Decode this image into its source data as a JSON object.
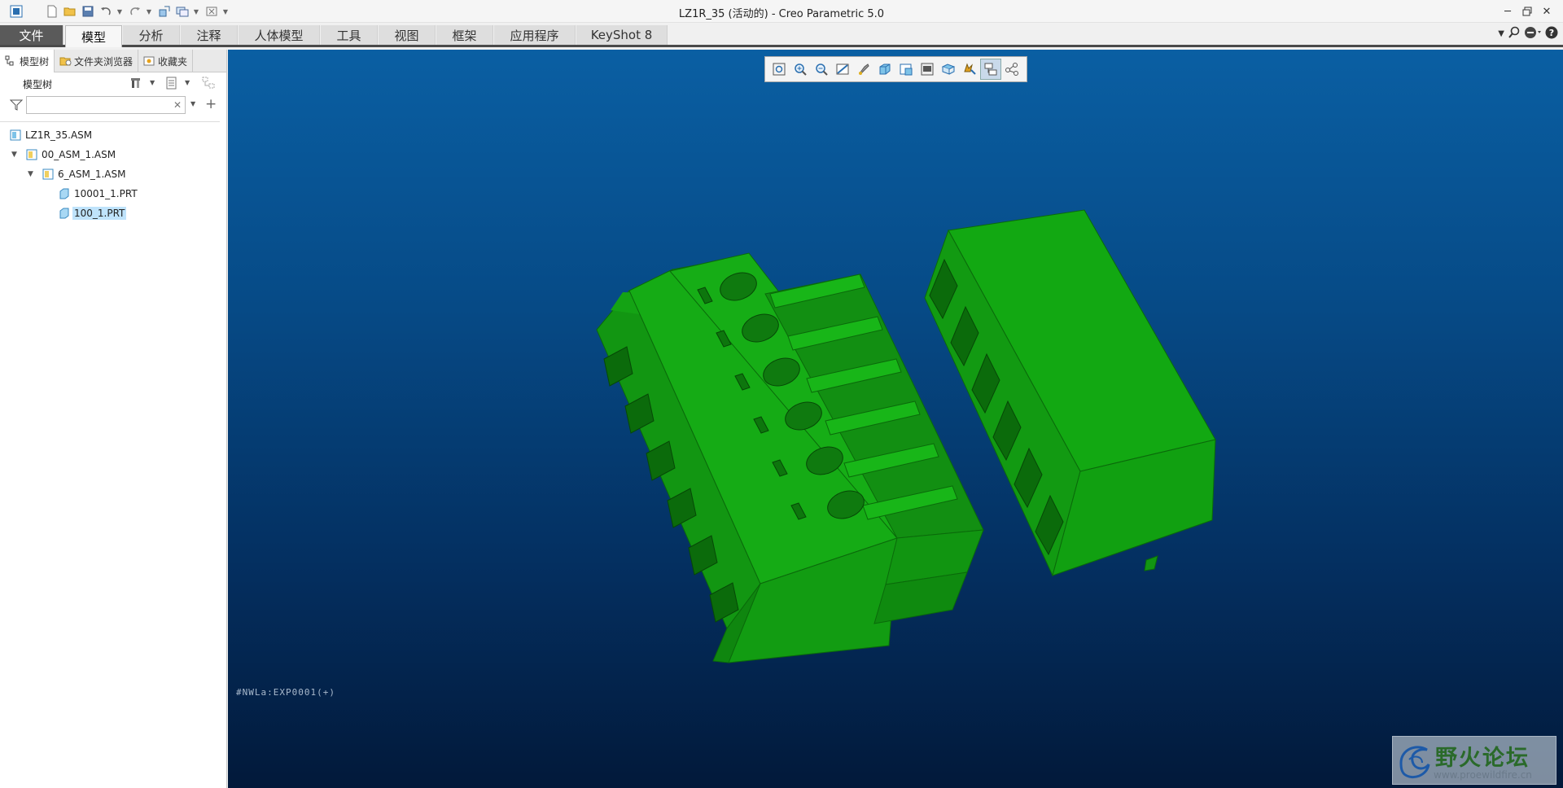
{
  "window": {
    "title": "LZ1R_35 (活动的) - Creo Parametric 5.0",
    "controls": [
      "minimize-icon",
      "restore-icon",
      "close-icon"
    ]
  },
  "quick_access": [
    "app-menu-icon",
    "new-icon",
    "open-icon",
    "save-icon",
    "undo-icon",
    "redo-icon",
    "regenerate-icon",
    "windows-icon",
    "close-window-icon",
    "customize-icon"
  ],
  "ribbon": {
    "tabs": [
      {
        "label": "文件",
        "kind": "file"
      },
      {
        "label": "模型",
        "kind": "active"
      },
      {
        "label": "分析"
      },
      {
        "label": "注释"
      },
      {
        "label": "人体模型"
      },
      {
        "label": "工具"
      },
      {
        "label": "视图"
      },
      {
        "label": "框架"
      },
      {
        "label": "应用程序"
      },
      {
        "label": "KeyShot 8"
      }
    ],
    "right_icons": [
      "collapse-ribbon-icon",
      "search-icon",
      "community-icon",
      "help-icon"
    ]
  },
  "navigator": {
    "tabs": [
      {
        "label": "模型树",
        "icon": "model-tree-icon",
        "active": true
      },
      {
        "label": "文件夹浏览器",
        "icon": "folder-browser-icon"
      },
      {
        "label": "收藏夹",
        "icon": "favorites-icon"
      }
    ],
    "tree_header": "模型树",
    "search": {
      "value": "",
      "placeholder": ""
    },
    "tree": [
      {
        "label": "LZ1R_35.ASM",
        "type": "asm",
        "level": 0,
        "expandable": false
      },
      {
        "label": "00_ASM_1.ASM",
        "type": "asm",
        "level": 1,
        "expandable": true
      },
      {
        "label": "6_ASM_1.ASM",
        "type": "asm",
        "level": 2,
        "expandable": true
      },
      {
        "label": "10001_1.PRT",
        "type": "prt",
        "level": 3,
        "expandable": false
      },
      {
        "label": "100_1.PRT",
        "type": "prt",
        "level": 3,
        "expandable": false,
        "selected": true
      }
    ]
  },
  "graphics": {
    "view_toolbar": [
      "refit-icon",
      "zoom-in-icon",
      "zoom-out-icon",
      "repaint-icon",
      "perspective-icon",
      "display-style-icon",
      "saved-orientations-icon",
      "view-manager-icon",
      "section-icon",
      "appearance-icon",
      "datum-display-icon",
      "annotation-display-icon",
      "spin-center-icon"
    ],
    "status_label": "#NWLa:EXP0001(+)",
    "model_color": "#12a412",
    "background_top": "#0a5fa3",
    "background_bottom": "#02193a"
  },
  "watermark": {
    "title": "野火论坛",
    "url": "www.proewildfire.cn"
  }
}
